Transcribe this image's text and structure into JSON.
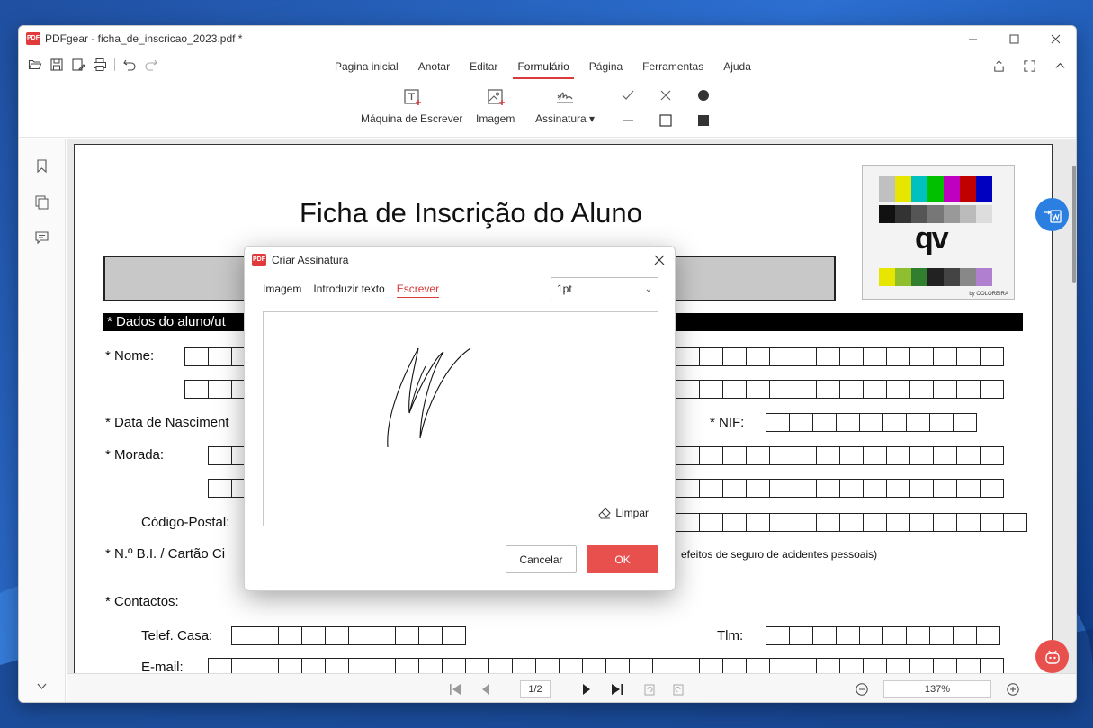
{
  "window": {
    "title": "PDFgear - ficha_de_inscricao_2023.pdf *"
  },
  "menu": {
    "items": [
      "Pagina inicial",
      "Anotar",
      "Editar",
      "Formulário",
      "Página",
      "Ferramentas",
      "Ajuda"
    ],
    "active": "Formulário"
  },
  "ribbon": {
    "typewriter_label": "Máquina de Escrever",
    "image_label": "Imagem",
    "signature_label": "Assinatura"
  },
  "document": {
    "title": "Ficha de Inscrição do Aluno",
    "section_header": "*  Dados do aluno/ut",
    "labels": {
      "nome": "Nome:",
      "nascimento": "Data de Nasciment",
      "nif": "NIF:",
      "morada": "Morada:",
      "codigo_postal": "Código-Postal:",
      "bi": "N.º B.I. / Cartão Ci",
      "bi_note": "efeitos de seguro de acidentes pessoais)",
      "contactos": "Contactos:",
      "telef_casa": "Telef. Casa:",
      "tlm": "Tlm:",
      "email": "E-mail:"
    },
    "testcard_caption": "by OOLOREIRA"
  },
  "status": {
    "page_display": "1/2",
    "zoom": "137%"
  },
  "dialog": {
    "title": "Criar Assinatura",
    "tabs": [
      "Imagem",
      "Introduzir texto",
      "Escrever"
    ],
    "active_tab": "Escrever",
    "thickness": "1pt",
    "clear_label": "Limpar",
    "cancel_label": "Cancelar",
    "ok_label": "OK"
  },
  "colors": {
    "accent": "#d93a3a",
    "ok_button": "#e8504e",
    "fab_blue": "#2b7fe0",
    "fab_red": "#e8504e"
  }
}
